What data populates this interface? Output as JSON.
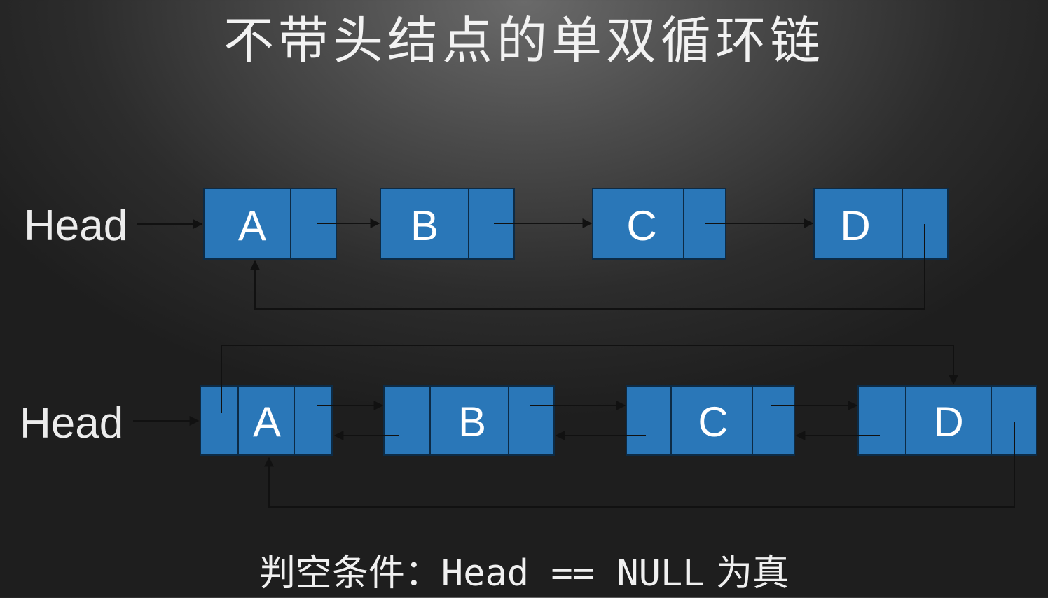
{
  "title": "不带头结点的单双循环链",
  "list1": {
    "head_label": "Head",
    "nodes": [
      "A",
      "B",
      "C",
      "D"
    ]
  },
  "list2": {
    "head_label": "Head",
    "nodes": [
      "A",
      "B",
      "C",
      "D"
    ]
  },
  "empty_condition": {
    "label": "判空条件：",
    "expression": "Head == NULL",
    "suffix": "为真"
  },
  "colors": {
    "node_fill": "#2a77b8",
    "background": "#3a3a3a",
    "text": "#f0f0f0"
  }
}
